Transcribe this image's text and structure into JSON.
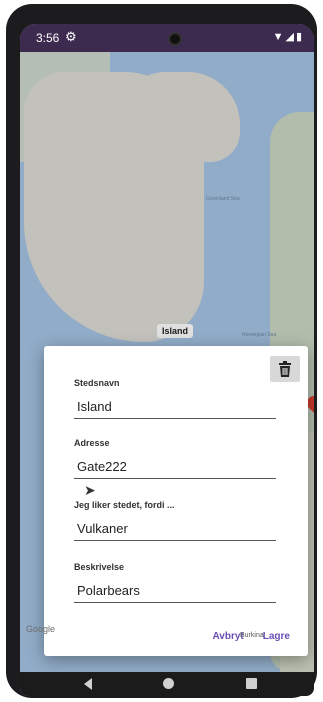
{
  "status_bar": {
    "time": "3:56"
  },
  "map": {
    "pin_label": "Island",
    "attribution": "Google",
    "place_labels": [
      "Greenland Sea",
      "Norwegian Sea",
      "Burkina"
    ]
  },
  "dialog": {
    "fields": [
      {
        "label": "Stedsnavn",
        "value": "Island"
      },
      {
        "label": "Adresse",
        "value": "Gate222"
      },
      {
        "label": "Jeg liker stedet, fordi ...",
        "value": "Vulkaner"
      },
      {
        "label": "Beskrivelse",
        "value": "Polarbears"
      }
    ],
    "cancel_label": "Avbryt",
    "save_label": "Lagre"
  },
  "icons": {
    "settings": "gear-icon",
    "wifi": "wifi-icon",
    "signal": "signal-icon",
    "battery": "battery-icon",
    "delete": "trash-icon",
    "nav_back": "back-icon",
    "nav_home": "home-icon",
    "nav_recents": "recents-icon"
  },
  "colors": {
    "status_bar": "#3c2a4f",
    "accent": "#6a4fb3",
    "pin": "#e34133"
  }
}
